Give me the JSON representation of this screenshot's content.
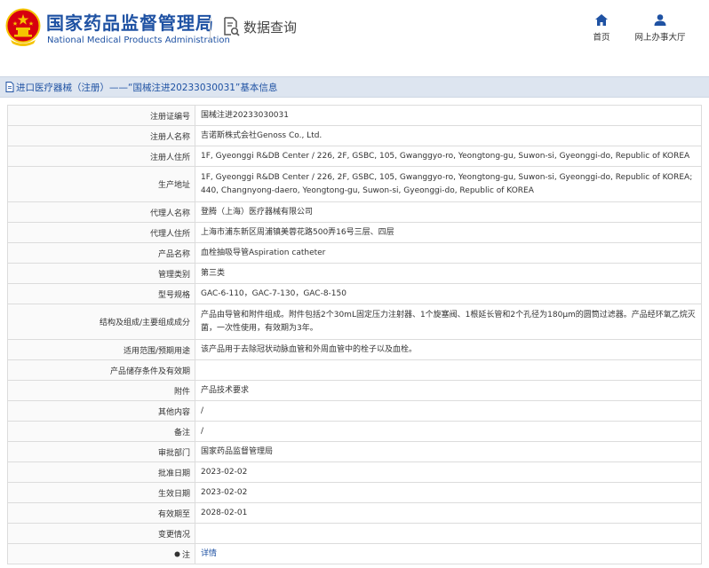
{
  "header": {
    "org_name_cn": "国家药品监督管理局",
    "org_name_en": "National Medical Products Administration",
    "query_title": "数据查询",
    "nav": [
      {
        "label": "首页",
        "icon": "home-icon"
      },
      {
        "label": "网上办事大厅",
        "icon": "user-icon"
      }
    ]
  },
  "title_bar": {
    "category_link": "进口医疗器械（注册）",
    "rest": "——“国械注进20233030031”基本信息"
  },
  "rows": [
    {
      "key": "注册证编号",
      "value": "国械注进20233030031"
    },
    {
      "key": "注册人名称",
      "value": "吉诺斯株式会社Genoss Co., Ltd."
    },
    {
      "key": "注册人住所",
      "value": "1F, Gyeonggi R&DB Center / 226, 2F, GSBC, 105, Gwanggyo-ro, Yeongtong-gu, Suwon-si, Gyeonggi-do, Republic of KOREA"
    },
    {
      "key": "生产地址",
      "value": "1F, Gyeonggi R&DB Center / 226, 2F, GSBC, 105, Gwanggyo-ro, Yeongtong-gu, Suwon-si, Gyeonggi-do, Republic of KOREA; 440, Changnyong-daero, Yeongtong-gu, Suwon-si, Gyeonggi-do, Republic of KOREA"
    },
    {
      "key": "代理人名称",
      "value": "登腾（上海）医疗器械有限公司"
    },
    {
      "key": "代理人住所",
      "value": "上海市浦东新区周浦镇美蓉花路500弄16号三层、四层"
    },
    {
      "key": "产品名称",
      "value": "血栓抽吸导管Aspiration catheter"
    },
    {
      "key": "管理类别",
      "value": "第三类"
    },
    {
      "key": "型号规格",
      "value": "GAC-6-110，GAC-7-130，GAC-8-150"
    },
    {
      "key": "结构及组成/主要组成成分",
      "value": "产品由导管和附件组成。附件包括2个30mL固定压力注射器、1个旋塞阀、1根延长管和2个孔径为180μm的圆筒过滤器。产品经环氧乙烷灭菌，一次性使用，有效期为3年。"
    },
    {
      "key": "适用范围/预期用途",
      "value": "该产品用于去除冠状动脉血管和外周血管中的栓子以及血栓。"
    },
    {
      "key": "产品储存条件及有效期",
      "value": ""
    },
    {
      "key": "附件",
      "value": "产品技术要求"
    },
    {
      "key": "其他内容",
      "value": "/"
    },
    {
      "key": "备注",
      "value": "/"
    },
    {
      "key": "审批部门",
      "value": "国家药品监督管理局"
    },
    {
      "key": "批准日期",
      "value": "2023-02-02"
    },
    {
      "key": "生效日期",
      "value": "2023-02-02"
    },
    {
      "key": "有效期至",
      "value": "2028-02-01"
    },
    {
      "key": "变更情况",
      "value": ""
    }
  ],
  "note_row": {
    "key": "注",
    "link": "详情"
  },
  "colors": {
    "brand_blue": "#1f52a3",
    "title_bar_bg": "#dde5f0",
    "emblem_red": "#d7000f",
    "emblem_gold": "#f5c400"
  }
}
